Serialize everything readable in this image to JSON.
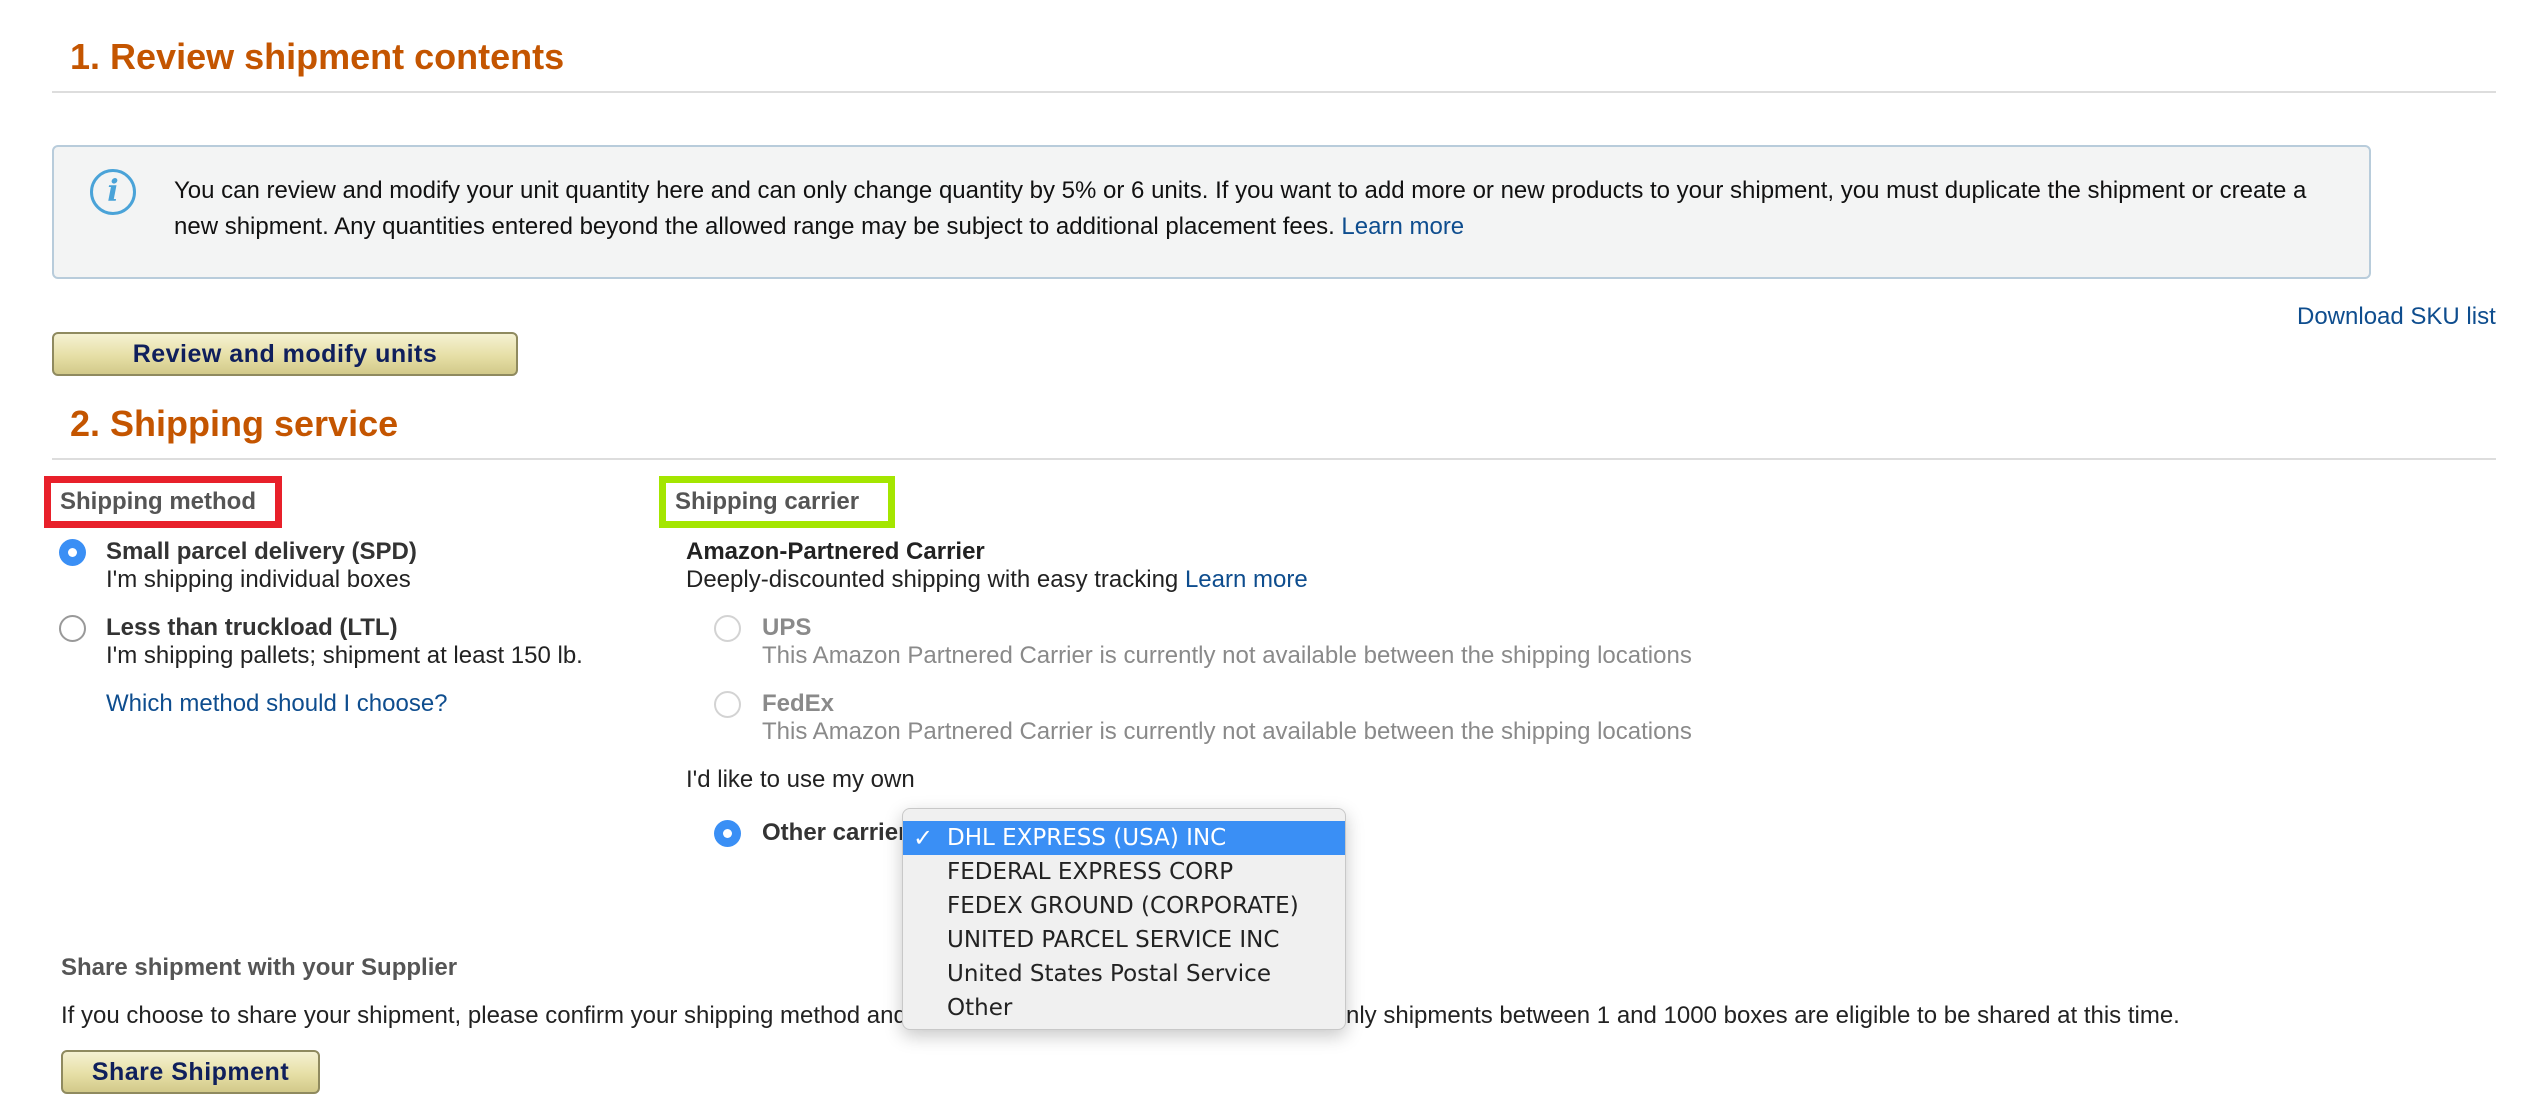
{
  "section1": {
    "title": "1. Review shipment contents",
    "info_text": "You can review and modify your unit quantity here and can only change quantity by 5% or 6 units. If you want to add more or new products to your shipment, you must duplicate the shipment or create a new shipment. Any quantities entered beyond the allowed range may be subject to additional placement fees.",
    "info_link": "Learn more",
    "download_link": "Download SKU list",
    "review_button": "Review and modify units"
  },
  "section2": {
    "title": "2. Shipping service",
    "shipping_method": {
      "label": "Shipping method",
      "highlight_color": "#e8202a",
      "options": [
        {
          "title": "Small parcel delivery (SPD)",
          "desc": "I'm shipping individual boxes",
          "selected": true
        },
        {
          "title": "Less than truckload (LTL)",
          "desc": "I'm shipping pallets; shipment at least 150 lb.",
          "selected": false
        }
      ],
      "help_link": "Which method should I choose?"
    },
    "shipping_carrier": {
      "label": "Shipping carrier",
      "highlight_color": "#a4e600",
      "partnered_title": "Amazon-Partnered Carrier",
      "partnered_desc": "Deeply-discounted shipping with easy tracking",
      "partnered_link": "Learn more",
      "carriers": [
        {
          "name": "UPS",
          "desc": "This Amazon Partnered Carrier is currently not available between the shipping locations",
          "disabled": true
        },
        {
          "name": "FedEx",
          "desc": "This Amazon Partnered Carrier is currently not available between the shipping locations",
          "disabled": true
        }
      ],
      "own_label": "I'd like to use my own",
      "other_carrier_label": "Other carrier",
      "dropdown": {
        "selected": "DHL EXPRESS (USA) INC",
        "check": "✓",
        "options": [
          "DHL EXPRESS (USA) INC",
          "FEDERAL EXPRESS CORP",
          "FEDEX GROUND (CORPORATE)",
          "UNITED PARCEL SERVICE INC",
          "United States Postal Service",
          "Other"
        ]
      }
    }
  },
  "share": {
    "title": "Share shipment with your Supplier",
    "text_before": "If you choose to share your shipment, please confirm your shipping method and",
    "text_after": "nly shipments between 1 and 1000 boxes are eligible to be shared at this time.",
    "button": "Share Shipment"
  },
  "colors": {
    "section_title": "#c45500",
    "link": "#0e4d8e",
    "radio_selected": "#3a8ff5",
    "dropdown_highlight": "#3a8ff5"
  }
}
